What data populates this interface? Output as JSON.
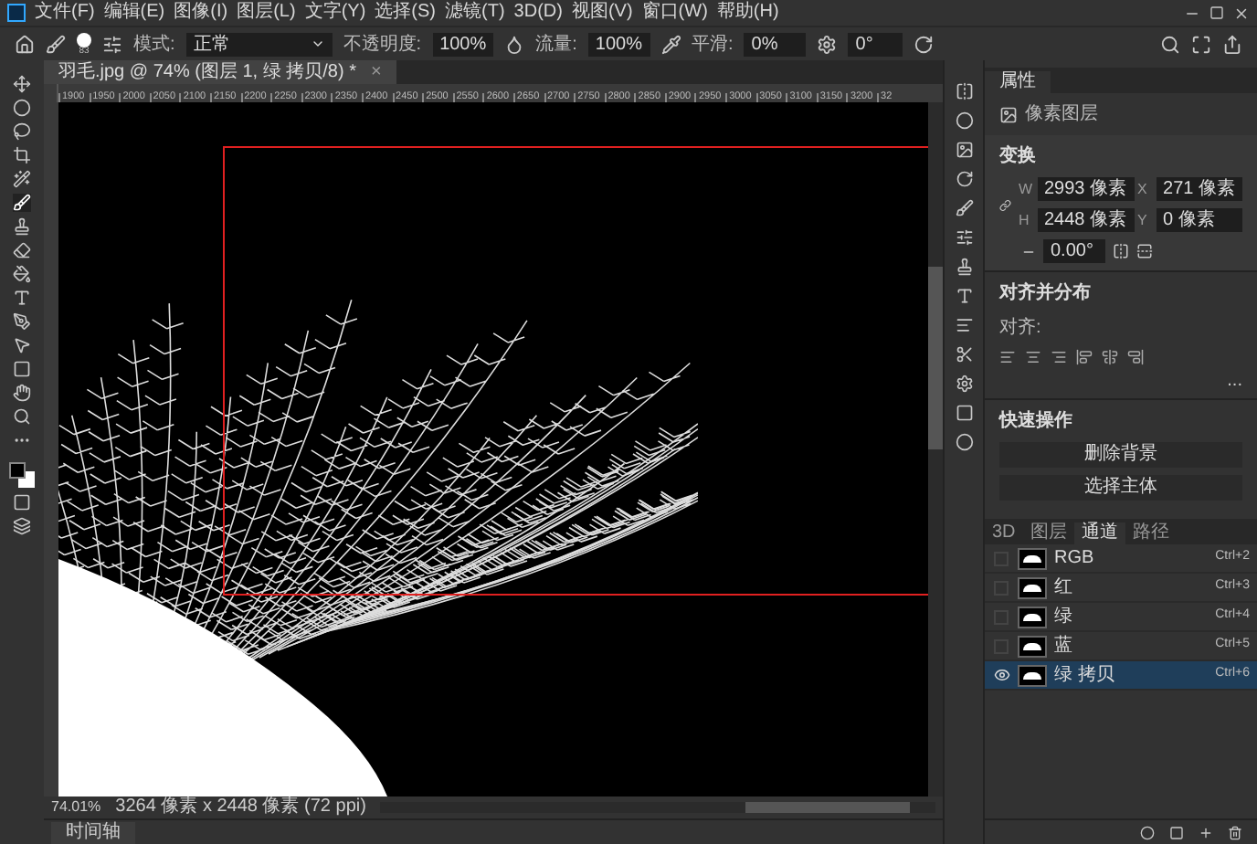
{
  "menu": [
    "文件(F)",
    "编辑(E)",
    "图像(I)",
    "图层(L)",
    "文字(Y)",
    "选择(S)",
    "滤镜(T)",
    "3D(D)",
    "视图(V)",
    "窗口(W)",
    "帮助(H)"
  ],
  "options": {
    "brush_size": "83",
    "mode_label": "模式:",
    "mode": "正常",
    "opacity_label": "不透明度:",
    "opacity": "100%",
    "flow_label": "流量:",
    "flow": "100%",
    "smooth_label": "平滑:",
    "smooth": "0%",
    "angle": "0°"
  },
  "document_tab": {
    "title": "羽毛.jpg @ 74% (图层 1, 绿 拷贝/8) *",
    "close": "×"
  },
  "ruler": [
    "1900",
    "1950",
    "2000",
    "2050",
    "2100",
    "2150",
    "2200",
    "2250",
    "2300",
    "2350",
    "2400",
    "2450",
    "2500",
    "2550",
    "2600",
    "2650",
    "2700",
    "2750",
    "2800",
    "2850",
    "2900",
    "2950",
    "3000",
    "3050",
    "3100",
    "3150",
    "3200",
    "32"
  ],
  "status_bar": {
    "zoom": "74.01%",
    "info": "3264 像素 x 2448 像素 (72 ppi)"
  },
  "timeline_tab": "时间轴",
  "properties": {
    "tab": "属性",
    "layer_type": "像素图层",
    "transform": {
      "title": "变换",
      "w_label": "W",
      "w": "2993 像素",
      "x_label": "X",
      "x": "271 像素",
      "h_label": "H",
      "h": "2448 像素",
      "y_label": "Y",
      "y": "0 像素",
      "angle": "0.00°"
    },
    "align": {
      "title": "对齐并分布",
      "label": "对齐:",
      "more": "..."
    },
    "quick_actions": {
      "title": "快速操作",
      "buttons": [
        "删除背景",
        "选择主体"
      ]
    }
  },
  "channels_panel": {
    "tabs": [
      {
        "label": "3D",
        "selected": false
      },
      {
        "label": "图层",
        "selected": false
      },
      {
        "label": "通道",
        "selected": true
      },
      {
        "label": "路径",
        "selected": false
      }
    ],
    "rows": [
      {
        "name": "RGB",
        "shortcut": "Ctrl+2",
        "visible": false,
        "selected": false
      },
      {
        "name": "红",
        "shortcut": "Ctrl+3",
        "visible": false,
        "selected": false
      },
      {
        "name": "绿",
        "shortcut": "Ctrl+4",
        "visible": false,
        "selected": false
      },
      {
        "name": "蓝",
        "shortcut": "Ctrl+5",
        "visible": false,
        "selected": false
      },
      {
        "name": "绿 拷贝",
        "shortcut": "Ctrl+6",
        "visible": true,
        "selected": true
      }
    ]
  }
}
